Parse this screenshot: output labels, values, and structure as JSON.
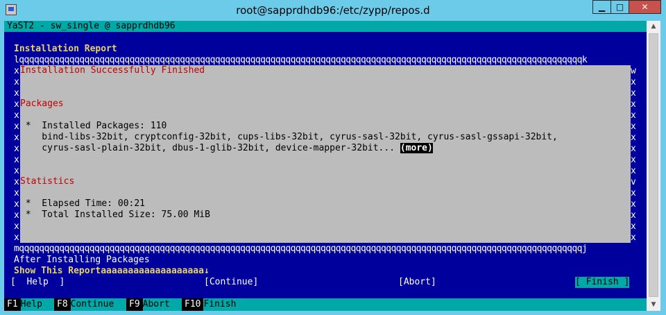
{
  "window": {
    "title": "root@sapprdhdb96:/etc/zypp/repos.d",
    "min_label": "▁",
    "max_label": "□",
    "close_label": "✕"
  },
  "terminal": {
    "header": "YaST2 - sw_single @ sapprdhdb96",
    "dialog_title": "Installation Report",
    "frame_top": "lqqqqqqqqqqqqqqqqqqqqqqqqqqqqqqqqqqqqqqqqqqqqqqqqqqqqqqqqqqqqqqqqqqqqqqqqqqqqqqqqqqqqqqqqqqqqqqqqqqqqqqqqqqqqqqqqk",
    "frame_bottom": "mqqqqqqqqqqqqqqqqqqqqqqqqqqqqqqqqqqqqqqqqqqqqqqqqqqqqqqqqqqqqqqqqqqqqqqqqqqqqqqqqqqqqqqqqqqqqqqqqqqqqqqqqqqqqqqqqj",
    "border_char": "x",
    "scroll_top": "w",
    "scroll_down": "v",
    "report": {
      "success": "Installation Successfully Finished",
      "packages_heading": "Packages",
      "installed_line": " *  Installed Packages: 110",
      "pkg_line1": "    bind-libs-32bit, cryptconfig-32bit, cups-libs-32bit, cyrus-sasl-32bit, cyrus-sasl-gssapi-32bit,",
      "pkg_line2": "    cyrus-sasl-plain-32bit, dbus-1-glib-32bit, device-mapper-32bit... ",
      "more": "(more)",
      "statistics_heading": "Statistics",
      "elapsed_line": " *  Elapsed Time: 00:21",
      "size_line": " *  Total Installed Size: 75.00 MiB"
    },
    "after_label": "After Installing Packages",
    "show_report_label": "Show This Report",
    "show_report_fill": "aaaaaaaaaaaaaaaaaaa",
    "show_report_arrow": "↓",
    "buttons": {
      "help": "[  Help  ]",
      "continue": "[Continue]",
      "abort": "[Abort]",
      "finish": "[ Finish ]"
    },
    "fkeys": [
      {
        "key": "F1",
        "label": "Help"
      },
      {
        "key": "F8",
        "label": "Continue"
      },
      {
        "key": "F9",
        "label": "Abort"
      },
      {
        "key": "F10",
        "label": "Finish"
      }
    ]
  },
  "scrollbar": {
    "up": "▲",
    "down": "▼"
  }
}
